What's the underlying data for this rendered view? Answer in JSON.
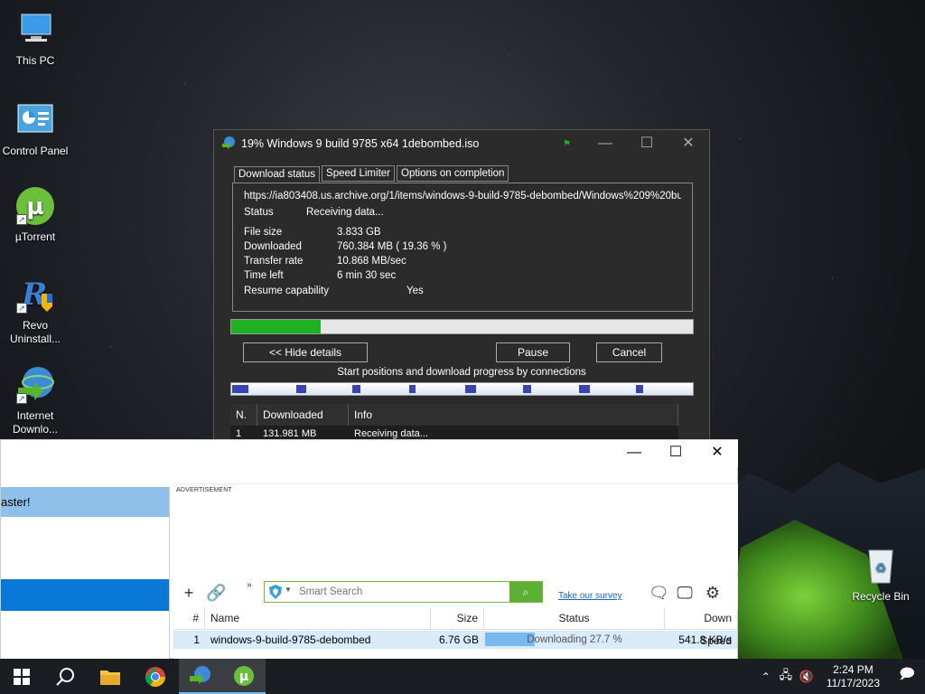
{
  "desktop": {
    "icons": [
      {
        "label": "This PC"
      },
      {
        "label": "Control Panel"
      },
      {
        "label": "µTorrent"
      },
      {
        "label": "Revo Uninstall..."
      },
      {
        "label": "Internet Downlo..."
      },
      {
        "label": "Recycle Bin"
      }
    ]
  },
  "idm": {
    "title": "19% Windows 9 build 9785 x64 1debombed.iso",
    "tabs": [
      "Download status",
      "Speed Limiter",
      "Options on completion"
    ],
    "url": "https://ia803408.us.archive.org/1/items/windows-9-build-9785-debombed/Windows%209%20build%",
    "status_label": "Status",
    "status_value": "Receiving data...",
    "file_size_label": "File size",
    "file_size_value": "3.833  GB",
    "downloaded_label": "Downloaded",
    "downloaded_value": "760.384  MB  ( 19.36 % )",
    "transfer_rate_label": "Transfer rate",
    "transfer_rate_value": "10.868  MB/sec",
    "time_left_label": "Time left",
    "time_left_value": "6 min 30 sec",
    "resume_label": "Resume capability",
    "resume_value": "Yes",
    "progress_percent": 19.36,
    "hide_details_label": "<< Hide details",
    "pause_label": "Pause",
    "cancel_label": "Cancel",
    "connections_label": "Start positions and download progress by connections",
    "table_headers": [
      "N.",
      "Downloaded",
      "Info"
    ],
    "table_rows": [
      {
        "n": "1",
        "downloaded": "131.981  MB",
        "info": "Receiving data..."
      }
    ],
    "colors": {
      "progress_fill": "#1fb124",
      "connection_segment": "#3a43b0"
    }
  },
  "utorrent": {
    "sidebar_item_text": "aster!",
    "ad_label": "ADVERTISEMENT",
    "search_placeholder": "Smart Search",
    "survey_link": "Take our survey",
    "grid_headers": [
      "#",
      "Name",
      "Size",
      "Status",
      "Down Speed"
    ],
    "torrents": [
      {
        "index": "1",
        "name": "windows-9-build-9785-debombed",
        "size": "6.76 GB",
        "status": "Downloading 27.7 %",
        "progress": 0.277,
        "down_speed": "541.8 KB/s"
      }
    ]
  },
  "taskbar": {
    "time": "2:24 PM",
    "date": "11/17/2023"
  }
}
